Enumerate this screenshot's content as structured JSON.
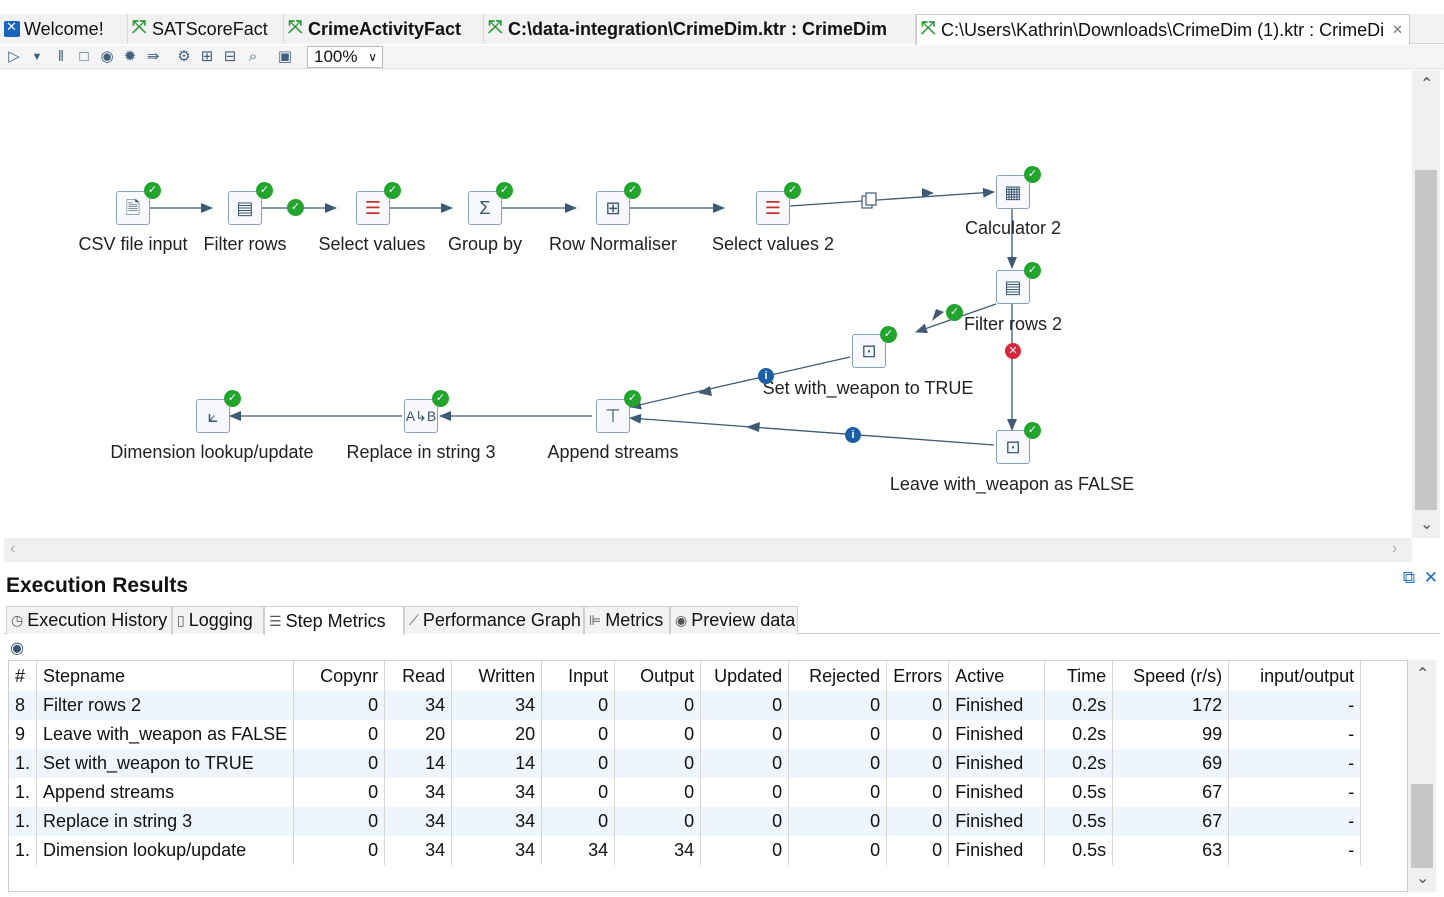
{
  "tabs": [
    {
      "label": "Welcome!",
      "icon": "kettle-icon",
      "bold": false
    },
    {
      "label": "SATScoreFact",
      "icon": "transformation-icon",
      "bold": false
    },
    {
      "label": "CrimeActivityFact",
      "icon": "transformation-icon",
      "bold": true
    },
    {
      "label": "C:\\data-integration\\CrimeDim.ktr : CrimeDim",
      "icon": "transformation-icon",
      "bold": true
    },
    {
      "label": "C:\\Users\\Kathrin\\Downloads\\CrimeDim (1).ktr : CrimeDi",
      "icon": "transformation-icon",
      "bold": false
    }
  ],
  "toolbar": {
    "zoom": "100%"
  },
  "canvas": {
    "steps": [
      {
        "id": "csv",
        "label": "CSV file input",
        "icon": "csv-file-input-icon"
      },
      {
        "id": "filter",
        "label": "Filter rows",
        "icon": "filter-rows-icon"
      },
      {
        "id": "select",
        "label": "Select values",
        "icon": "select-values-icon"
      },
      {
        "id": "groupby",
        "label": "Group by",
        "icon": "group-by-icon"
      },
      {
        "id": "normaliser",
        "label": "Row Normaliser",
        "icon": "row-normaliser-icon"
      },
      {
        "id": "select2",
        "label": "Select values 2",
        "icon": "select-values-icon"
      },
      {
        "id": "calc2",
        "label": "Calculator 2",
        "icon": "calculator-icon"
      },
      {
        "id": "filter2",
        "label": "Filter rows 2",
        "icon": "filter-rows-icon"
      },
      {
        "id": "settrue",
        "label": "Set with_weapon to TRUE",
        "icon": "constant-icon"
      },
      {
        "id": "leavefalse",
        "label": "Leave with_weapon as FALSE",
        "icon": "constant-icon"
      },
      {
        "id": "append",
        "label": "Append streams",
        "icon": "append-streams-icon"
      },
      {
        "id": "replace",
        "label": "Replace in string 3",
        "icon": "replace-in-string-icon"
      },
      {
        "id": "dimlookup",
        "label": "Dimension lookup/update",
        "icon": "dimension-lookup-icon"
      }
    ]
  },
  "results": {
    "title": "Execution Results",
    "tabs": [
      {
        "label": "Execution History",
        "icon": "history-icon"
      },
      {
        "label": "Logging",
        "icon": "logging-icon"
      },
      {
        "label": "Step Metrics",
        "icon": "step-metrics-icon"
      },
      {
        "label": "Performance Graph",
        "icon": "performance-graph-icon"
      },
      {
        "label": "Metrics",
        "icon": "metrics-icon"
      },
      {
        "label": "Preview data",
        "icon": "preview-icon"
      }
    ],
    "active_tab": "Step Metrics",
    "columns": [
      "#",
      "Stepname",
      "Copynr",
      "Read",
      "Written",
      "Input",
      "Output",
      "Updated",
      "Rejected",
      "Errors",
      "Active",
      "Time",
      "Speed (r/s)",
      "input/output"
    ],
    "rows": [
      [
        "8",
        "Filter rows 2",
        "0",
        "34",
        "34",
        "0",
        "0",
        "0",
        "0",
        "0",
        "Finished",
        "0.2s",
        "172",
        "-"
      ],
      [
        "9",
        "Leave with_weapon as FALSE",
        "0",
        "20",
        "20",
        "0",
        "0",
        "0",
        "0",
        "0",
        "Finished",
        "0.2s",
        "99",
        "-"
      ],
      [
        "1.",
        "Set with_weapon to TRUE",
        "0",
        "14",
        "14",
        "0",
        "0",
        "0",
        "0",
        "0",
        "Finished",
        "0.2s",
        "69",
        "-"
      ],
      [
        "1.",
        "Append streams",
        "0",
        "34",
        "34",
        "0",
        "0",
        "0",
        "0",
        "0",
        "Finished",
        "0.5s",
        "67",
        "-"
      ],
      [
        "1.",
        "Replace in string 3",
        "0",
        "34",
        "34",
        "0",
        "0",
        "0",
        "0",
        "0",
        "Finished",
        "0.5s",
        "67",
        "-"
      ],
      [
        "1.",
        "Dimension lookup/update",
        "0",
        "34",
        "34",
        "34",
        "34",
        "0",
        "0",
        "0",
        "Finished",
        "0.5s",
        "63",
        "-"
      ]
    ]
  },
  "colors": {
    "ok": "#22a52c",
    "error": "#d9263a",
    "info": "#1a5fa8",
    "hop": "#3f5a74",
    "row_alt": "#eef5fc"
  }
}
